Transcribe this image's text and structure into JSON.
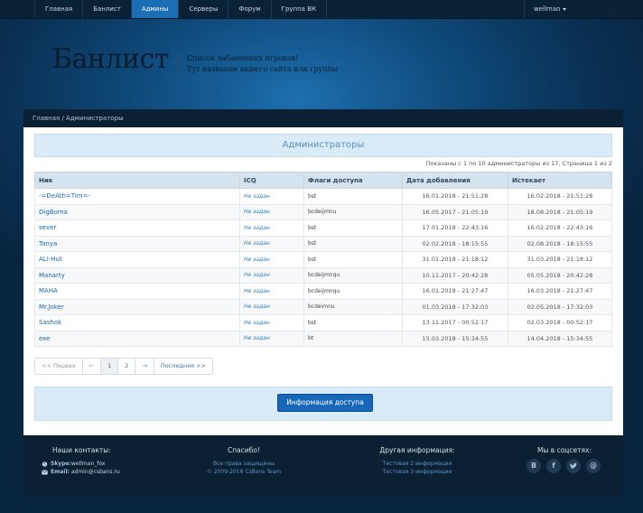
{
  "nav": {
    "items": [
      {
        "label": "Главная",
        "active": false
      },
      {
        "label": "Банлист",
        "active": false
      },
      {
        "label": "Админы",
        "active": true
      },
      {
        "label": "Серверы",
        "active": false
      },
      {
        "label": "Форум",
        "active": false
      },
      {
        "label": "Группа ВК",
        "active": false
      }
    ],
    "user": "wellman"
  },
  "header": {
    "title": "Банлист",
    "desc_line1": "Список забаненных игроков!",
    "desc_line2": "Тут название вашего сайта или группы"
  },
  "breadcrumb": "Главная / Администраторы",
  "panel": {
    "title": "Администраторы",
    "pager_info": "Показаны с 1 по 10 администраторы из 17. Страница 1 из 2"
  },
  "table": {
    "headers": [
      "Ник",
      "ICQ",
      "Флаги доступа",
      "Дата добавления",
      "Истекает"
    ],
    "rows": [
      {
        "nick": "-=DeAth=Tim=-",
        "icq": "Не задан",
        "flags": "bst",
        "added": "16.01.2018 - 21:51:28",
        "expires": "16.02.2018 - 21:51:28"
      },
      {
        "nick": "DigBoma",
        "icq": "Не задан",
        "flags": "bcdeijmnu",
        "added": "16.05.2017 - 21:05:19",
        "expires": "18.08.2018 - 21:05:19"
      },
      {
        "nick": "sever",
        "icq": "Не задан",
        "flags": "bst",
        "added": "17.01.2018 - 22:43:16",
        "expires": "16.02.2018 - 22:43:16"
      },
      {
        "nick": "Tanya",
        "icq": "Не задан",
        "flags": "bst",
        "added": "02.02.2018 - 18:15:55",
        "expires": "02.08.2018 - 18:15:55"
      },
      {
        "nick": "ALI-Hut",
        "icq": "Не задан",
        "flags": "bst",
        "added": "31.01.2018 - 21:18:12",
        "expires": "31.03.2018 - 21:18:12"
      },
      {
        "nick": "Manarty",
        "icq": "Не задан",
        "flags": "bcdeijmnqu",
        "added": "10.11.2017 - 20:42:28",
        "expires": "05.05.2018 - 20:42:28"
      },
      {
        "nick": "MAHA",
        "icq": "Не задан",
        "flags": "bcdeijmnqu",
        "added": "16.01.2018 - 21:27:47",
        "expires": "16.03.2018 - 21:27:47"
      },
      {
        "nick": "Mr.Joker",
        "icq": "Не задан",
        "flags": "bcdeimnu",
        "added": "01.03.2018 - 17:32:03",
        "expires": "02.05.2018 - 17:32:03"
      },
      {
        "nick": "Sashok",
        "icq": "Не задан",
        "flags": "bst",
        "added": "13.11.2017 - 00:52:17",
        "expires": "02.03.2018 - 00:52:17"
      },
      {
        "nick": "exe",
        "icq": "Не задан",
        "flags": "bt",
        "added": "15.03.2018 - 15:34:55",
        "expires": "14.04.2018 - 15:34:55"
      }
    ]
  },
  "pagination": {
    "first": "<< Первая",
    "prev": "←",
    "pages": [
      "1",
      "2"
    ],
    "active_page": "1",
    "next": "→",
    "last": "Последняя >>"
  },
  "access_button": "Информация доступа",
  "footer": {
    "contacts": {
      "title": "Наши контакты:",
      "skype_label": "Skype:",
      "skype_value": "wellman_fox",
      "email_label": "Email:",
      "email_value": "admin@csbans.ru"
    },
    "thanks": {
      "title": "Спасибо!",
      "line1": "Все права защищены",
      "line2": "© 2009-2018 CsBans Team"
    },
    "other": {
      "title": "Другая информация:",
      "line1": "Тестовая 2 информация",
      "line2": "Тестовая 3 информация"
    },
    "social": {
      "title": "Мы в соцсетях:",
      "icons": [
        "vk-icon",
        "facebook-icon",
        "twitter-icon",
        "email-icon"
      ]
    }
  },
  "colors": {
    "accent": "#1767b8",
    "nav_active": "#1b6fb5",
    "panel_bg": "#d9ebf6"
  }
}
